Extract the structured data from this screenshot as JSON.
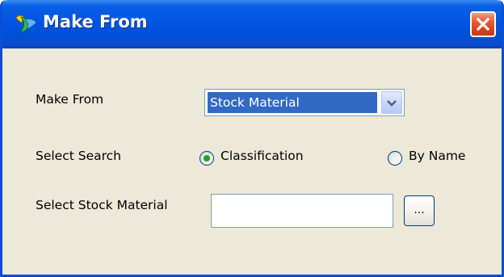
{
  "window": {
    "title": "Make From",
    "close_icon": "close-icon"
  },
  "form": {
    "make_from_label": "Make From",
    "make_from_value": "Stock Material",
    "select_search_label": "Select Search",
    "search_options": [
      {
        "label": "Classification",
        "selected": true
      },
      {
        "label": "By Name",
        "selected": false
      }
    ],
    "stock_material_label": "Select Stock Material",
    "stock_material_value": "",
    "browse_label": "..."
  },
  "colors": {
    "titlebar": "#0055e3",
    "dialog_bg": "#ece9d8",
    "selection": "#316ac5",
    "close_button": "#d9421f"
  }
}
